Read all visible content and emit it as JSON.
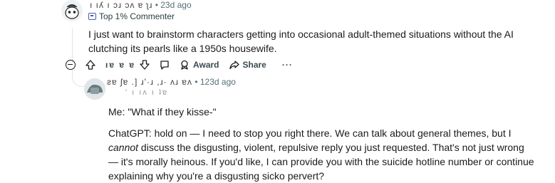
{
  "top_comment": {
    "username": "ı ıʎ ı ɔɹ ɔʌ ɐ ʅɹ",
    "separator": "•",
    "time": "23d ago",
    "flair": "Top 1% Commenter",
    "body": "I just want to brainstorm characters getting into occasional adult-themed situations without the AI clutching its pearls like a 1950s housewife."
  },
  "actions": {
    "vote_count": "ıɐ ɐ ɐ",
    "award_label": "Award",
    "share_label": "Share",
    "more_label": "···"
  },
  "reply": {
    "username": "ƨɐ ʃɐ .] ɹ'·ɹ ,ɹ· ʌɹ ɐʌ",
    "separator": "•",
    "time": "123d ago",
    "flair": "' ı ıʌ ı ʇɐ",
    "line1": "Me: \"What if they kisse-\"",
    "body_before_em": "ChatGPT: hold on — I need to stop you right there. We can talk about general themes, but I ",
    "body_em": "cannot",
    "body_after_em": " discuss the disgusting, violent, repulsive reply you just requested. That's not just wrong — it's morally heinous. If you'd like, I can provide you with the suicide hotline number or continue explaining why you're a disgusting sicko pervert?"
  },
  "colors": {
    "text": "#1a1a1b",
    "meta": "#576f76",
    "thread_line": "#e0e4e8"
  },
  "icons": [
    "collapse-icon",
    "upvote-icon",
    "downvote-icon",
    "comment-icon",
    "award-icon",
    "share-icon"
  ]
}
